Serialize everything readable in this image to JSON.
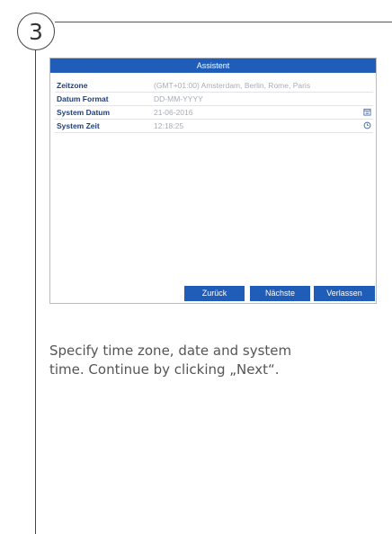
{
  "step": {
    "number": "3"
  },
  "dialog": {
    "title": "Assistent",
    "rows": [
      {
        "label": "Zeitzone",
        "value": "(GMT+01:00) Amsterdam, Berlin, Rome, Paris",
        "icon": ""
      },
      {
        "label": "Datum Format",
        "value": "DD-MM-YYYY",
        "icon": ""
      },
      {
        "label": "System Datum",
        "value": "21-06-2016",
        "icon": "calendar-icon"
      },
      {
        "label": "System Zeit",
        "value": "12:18:25",
        "icon": "clock-icon"
      }
    ],
    "buttons": {
      "back": "Zurück",
      "next": "Nächste",
      "leave": "Verlassen"
    }
  },
  "caption": {
    "line1": "Specify time zone, date and system",
    "line2": "time. Continue by clicking „Next“."
  },
  "colors": {
    "accent": "#1f5db8",
    "label": "#1f3f78",
    "value": "#a8adb6"
  }
}
